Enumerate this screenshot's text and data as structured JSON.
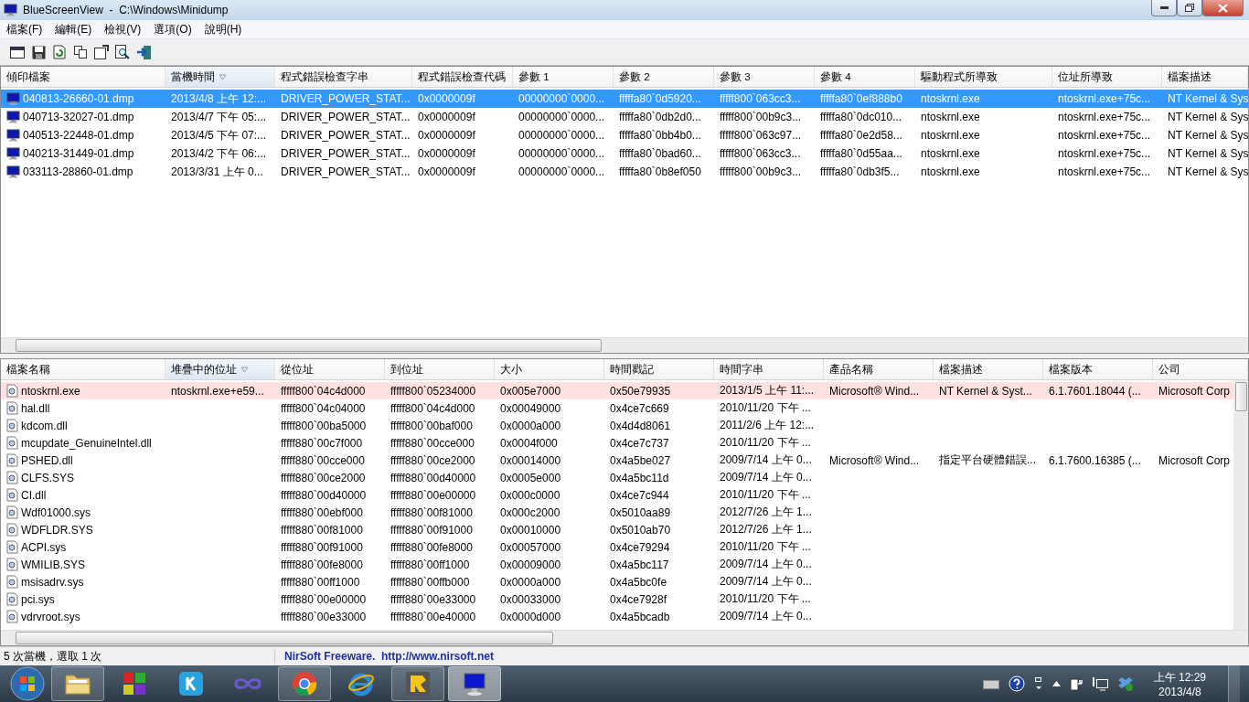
{
  "window": {
    "title": "BlueScreenView  -  C:\\Windows\\Minidump"
  },
  "menu": [
    "檔案(F)",
    "編輯(E)",
    "檢視(V)",
    "選項(O)",
    "說明(H)"
  ],
  "crash_list": {
    "columns": [
      {
        "label": "傾印檔案",
        "sorted": false
      },
      {
        "label": "當機時間",
        "sorted": true
      },
      {
        "label": "程式錯誤檢查字串",
        "sorted": false
      },
      {
        "label": "程式錯誤檢查代碼",
        "sorted": false
      },
      {
        "label": "參數 1",
        "sorted": false
      },
      {
        "label": "參數 2",
        "sorted": false
      },
      {
        "label": "參數 3",
        "sorted": false
      },
      {
        "label": "參數 4",
        "sorted": false
      },
      {
        "label": "驅動程式所導致",
        "sorted": false
      },
      {
        "label": "位址所導致",
        "sorted": false
      },
      {
        "label": "檔案描述",
        "sorted": false
      }
    ],
    "rows": [
      {
        "selected": true,
        "cells": [
          "040813-26660-01.dmp",
          "2013/4/8 上午 12:...",
          "DRIVER_POWER_STAT...",
          "0x0000009f",
          "00000000`0000...",
          "fffffa80`0d5920...",
          "fffff800`063cc3...",
          "fffffa80`0ef888b0",
          "ntoskrnl.exe",
          "ntoskrnl.exe+75c...",
          "NT Kernel & Sys"
        ]
      },
      {
        "selected": false,
        "cells": [
          "040713-32027-01.dmp",
          "2013/4/7 下午 05:...",
          "DRIVER_POWER_STAT...",
          "0x0000009f",
          "00000000`0000...",
          "fffffa80`0db2d0...",
          "fffff800`00b9c3...",
          "fffffa80`0dc010...",
          "ntoskrnl.exe",
          "ntoskrnl.exe+75c...",
          "NT Kernel & Sys"
        ]
      },
      {
        "selected": false,
        "cells": [
          "040513-22448-01.dmp",
          "2013/4/5 下午 07:...",
          "DRIVER_POWER_STAT...",
          "0x0000009f",
          "00000000`0000...",
          "fffffa80`0bb4b0...",
          "fffff800`063c97...",
          "fffffa80`0e2d58...",
          "ntoskrnl.exe",
          "ntoskrnl.exe+75c...",
          "NT Kernel & Sys"
        ]
      },
      {
        "selected": false,
        "cells": [
          "040213-31449-01.dmp",
          "2013/4/2 下午 06:...",
          "DRIVER_POWER_STAT...",
          "0x0000009f",
          "00000000`0000...",
          "fffffa80`0bad60...",
          "fffff800`063cc3...",
          "fffffa80`0d55aa...",
          "ntoskrnl.exe",
          "ntoskrnl.exe+75c...",
          "NT Kernel & Sys"
        ]
      },
      {
        "selected": false,
        "cells": [
          "033113-28860-01.dmp",
          "2013/3/31 上午 0...",
          "DRIVER_POWER_STAT...",
          "0x0000009f",
          "00000000`0000...",
          "fffffa80`0b8ef050",
          "fffff800`00b9c3...",
          "fffffa80`0db3f5...",
          "ntoskrnl.exe",
          "ntoskrnl.exe+75c...",
          "NT Kernel & Sys"
        ]
      }
    ]
  },
  "module_list": {
    "columns": [
      {
        "label": "檔案名稱",
        "sorted": false
      },
      {
        "label": "堆疊中的位址",
        "sorted": true
      },
      {
        "label": "從位址",
        "sorted": false
      },
      {
        "label": "到位址",
        "sorted": false
      },
      {
        "label": "大小",
        "sorted": false
      },
      {
        "label": "時間戳記",
        "sorted": false
      },
      {
        "label": "時間字串",
        "sorted": false
      },
      {
        "label": "產品名稱",
        "sorted": false
      },
      {
        "label": "檔案描述",
        "sorted": false
      },
      {
        "label": "檔案版本",
        "sorted": false
      },
      {
        "label": "公司",
        "sorted": false
      }
    ],
    "rows": [
      {
        "highlighted": true,
        "cells": [
          "ntoskrnl.exe",
          "ntoskrnl.exe+e59...",
          "fffff800`04c4d000",
          "fffff800`05234000",
          "0x005e7000",
          "0x50e79935",
          "2013/1/5 上午 11:...",
          "Microsoft® Wind...",
          "NT Kernel & Syst...",
          "6.1.7601.18044 (...",
          "Microsoft Corp"
        ]
      },
      {
        "highlighted": false,
        "cells": [
          "hal.dll",
          null,
          "fffff800`04c04000",
          "fffff800`04c4d000",
          "0x00049000",
          "0x4ce7c669",
          "2010/11/20 下午 ...",
          null,
          null,
          null,
          null
        ]
      },
      {
        "highlighted": false,
        "cells": [
          "kdcom.dll",
          null,
          "fffff800`00ba5000",
          "fffff800`00baf000",
          "0x0000a000",
          "0x4d4d8061",
          "2011/2/6 上午 12:...",
          null,
          null,
          null,
          null
        ]
      },
      {
        "highlighted": false,
        "cells": [
          "mcupdate_GenuineIntel.dll",
          null,
          "fffff880`00c7f000",
          "fffff880`00cce000",
          "0x0004f000",
          "0x4ce7c737",
          "2010/11/20 下午 ...",
          null,
          null,
          null,
          null
        ]
      },
      {
        "highlighted": false,
        "cells": [
          "PSHED.dll",
          null,
          "fffff880`00cce000",
          "fffff880`00ce2000",
          "0x00014000",
          "0x4a5be027",
          "2009/7/14 上午 0...",
          "Microsoft® Wind...",
          "指定平台硬體錯誤...",
          "6.1.7600.16385 (...",
          "Microsoft Corp"
        ]
      },
      {
        "highlighted": false,
        "cells": [
          "CLFS.SYS",
          null,
          "fffff880`00ce2000",
          "fffff880`00d40000",
          "0x0005e000",
          "0x4a5bc11d",
          "2009/7/14 上午 0...",
          null,
          null,
          null,
          null
        ]
      },
      {
        "highlighted": false,
        "cells": [
          "CI.dll",
          null,
          "fffff880`00d40000",
          "fffff880`00e00000",
          "0x000c0000",
          "0x4ce7c944",
          "2010/11/20 下午 ...",
          null,
          null,
          null,
          null
        ]
      },
      {
        "highlighted": false,
        "cells": [
          "Wdf01000.sys",
          null,
          "fffff880`00ebf000",
          "fffff880`00f81000",
          "0x000c2000",
          "0x5010aa89",
          "2012/7/26 上午 1...",
          null,
          null,
          null,
          null
        ]
      },
      {
        "highlighted": false,
        "cells": [
          "WDFLDR.SYS",
          null,
          "fffff880`00f81000",
          "fffff880`00f91000",
          "0x00010000",
          "0x5010ab70",
          "2012/7/26 上午 1...",
          null,
          null,
          null,
          null
        ]
      },
      {
        "highlighted": false,
        "cells": [
          "ACPI.sys",
          null,
          "fffff880`00f91000",
          "fffff880`00fe8000",
          "0x00057000",
          "0x4ce79294",
          "2010/11/20 下午 ...",
          null,
          null,
          null,
          null
        ]
      },
      {
        "highlighted": false,
        "cells": [
          "WMILIB.SYS",
          null,
          "fffff880`00fe8000",
          "fffff880`00ff1000",
          "0x00009000",
          "0x4a5bc117",
          "2009/7/14 上午 0...",
          null,
          null,
          null,
          null
        ]
      },
      {
        "highlighted": false,
        "cells": [
          "msisadrv.sys",
          null,
          "fffff880`00ff1000",
          "fffff880`00ffb000",
          "0x0000a000",
          "0x4a5bc0fe",
          "2009/7/14 上午 0...",
          null,
          null,
          null,
          null
        ]
      },
      {
        "highlighted": false,
        "cells": [
          "pci.sys",
          null,
          "fffff880`00e00000",
          "fffff880`00e33000",
          "0x00033000",
          "0x4ce7928f",
          "2010/11/20 下午 ...",
          null,
          null,
          null,
          null
        ]
      },
      {
        "highlighted": false,
        "cells": [
          "vdrvroot.sys",
          null,
          "fffff880`00e33000",
          "fffff880`00e40000",
          "0x0000d000",
          "0x4a5bcadb",
          "2009/7/14 上午 0...",
          null,
          null,
          null,
          null
        ]
      }
    ]
  },
  "status_bar": {
    "summary": "5 次當機，選取 1 次",
    "link": "NirSoft Freeware.  http://www.nirsoft.net"
  },
  "taskbar": {
    "items": [
      {
        "kind": "folder",
        "running": true,
        "selected": false
      },
      {
        "kind": "tiles",
        "running": false,
        "selected": false
      },
      {
        "kind": "k-logo",
        "running": false,
        "selected": false
      },
      {
        "kind": "infinity",
        "running": false,
        "selected": false
      },
      {
        "kind": "browser",
        "running": true,
        "selected": false
      },
      {
        "kind": "e-logo",
        "running": false,
        "selected": false
      },
      {
        "kind": "letter-logo",
        "running": true,
        "selected": false
      },
      {
        "kind": "monitor",
        "running": true,
        "selected": true
      }
    ],
    "clock": {
      "time": "上午 12:29",
      "date": "2013/4/8"
    }
  }
}
